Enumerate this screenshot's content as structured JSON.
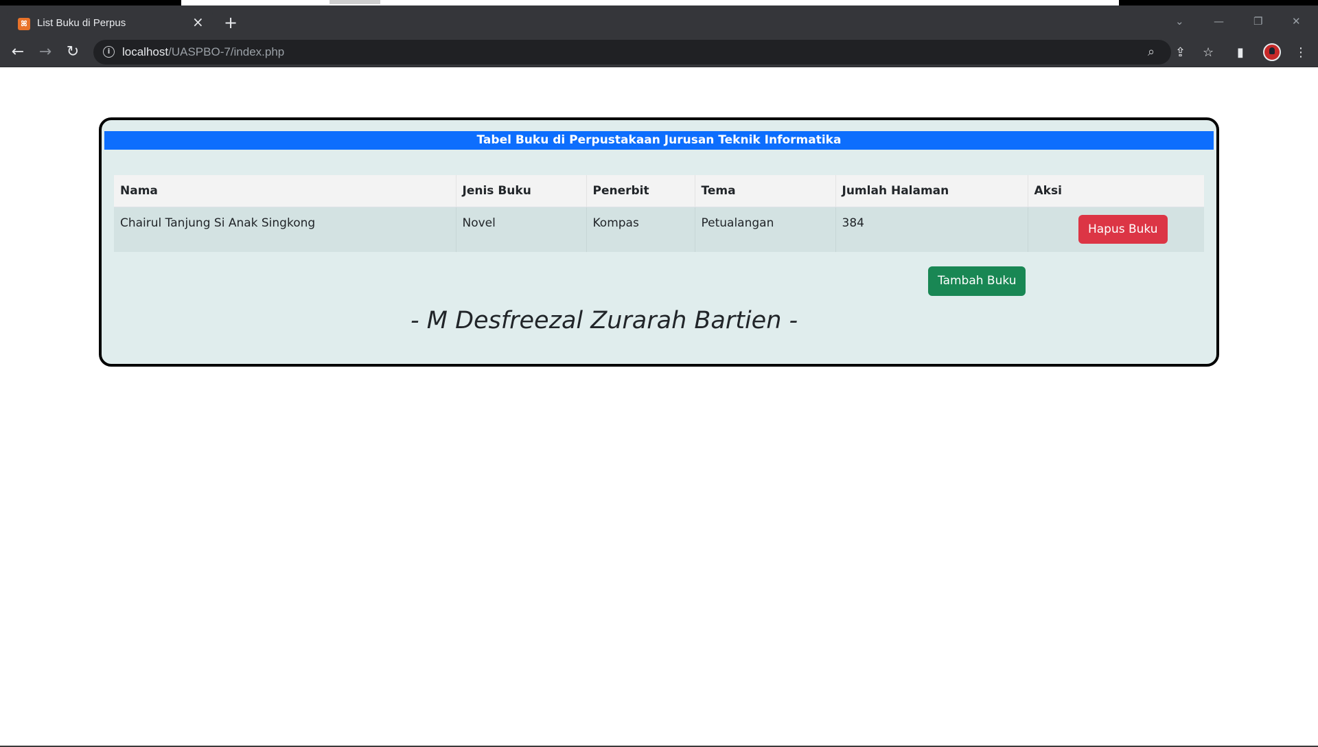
{
  "browser": {
    "tab_title": "List Buku di Perpus",
    "tab_close": "×",
    "new_tab": "+",
    "url_host": "localhost",
    "url_path": "/UASPBO-7/index.php",
    "icons": {
      "back": "back-arrow-icon",
      "forward": "forward-arrow-icon",
      "reload": "reload-icon",
      "info": "info-icon",
      "zoom": "zoom-icon",
      "share": "share-icon",
      "bookmark": "star-icon",
      "sidepanel": "side-panel-icon",
      "menu": "kebab-menu-icon"
    }
  },
  "card": {
    "header": "Tabel Buku di Perpustakaan Jurusan Teknik Informatika",
    "table": {
      "columns": [
        "Nama",
        "Jenis Buku",
        "Penerbit",
        "Tema",
        "Jumlah Halaman",
        "Aksi"
      ],
      "rows": [
        {
          "nama": "Chairul Tanjung Si Anak Singkong",
          "jenis": "Novel",
          "penerbit": "Kompas",
          "tema": "Petualangan",
          "halaman": "384",
          "aksi_label": "Hapus Buku"
        }
      ]
    },
    "add_button": "Tambah Buku",
    "signature": "- M Desfreezal Zurarah Bartien -"
  },
  "colors": {
    "header_blue": "#0d6efd",
    "danger_red": "#dc3545",
    "success_green": "#198754",
    "card_bg": "#e0eded"
  }
}
